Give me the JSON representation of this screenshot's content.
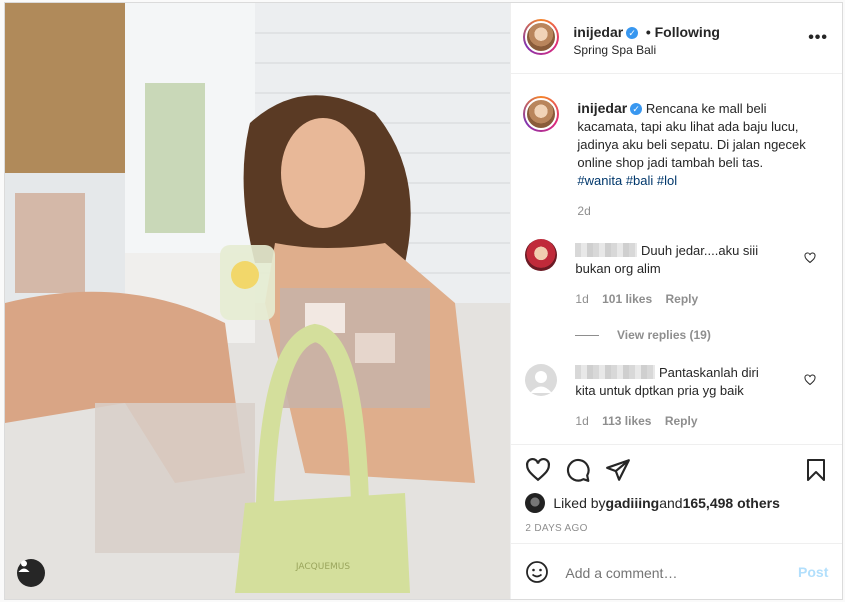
{
  "post": {
    "username": "inijedar",
    "following_label": "• Following",
    "location": "Spring Spa Bali",
    "caption": "Rencana ke mall beli kacamata, tapi aku lihat ada baju lucu, jadinya aku beli sepatu. Di jalan ngecek online shop jadi tambah beli tas.",
    "hashtags": [
      "#wanita",
      "#bali",
      "#lol"
    ],
    "caption_age": "2d",
    "bag_brand": "JACQUEMUS"
  },
  "comments": [
    {
      "text_line1": "Duuh jedar....aku siii",
      "text_line2": "bukan org alim",
      "age": "1d",
      "likes": "101 likes",
      "reply": "Reply"
    },
    {
      "text_line1": "Pantaskanlah diri",
      "text_line2": "kita untuk dptkan pria yg baik",
      "age": "1d",
      "likes": "113 likes",
      "reply": "Reply"
    }
  ],
  "view_replies": "View replies (19)",
  "likes": {
    "prefix": "Liked by ",
    "user": "gadiiing",
    "middle": " and ",
    "count": "165,498 others"
  },
  "timestamp": "2 DAYS AGO",
  "add_comment": {
    "placeholder": "Add a comment…",
    "post_label": "Post"
  },
  "colors": {
    "link": "#00376b",
    "post_button": "#b2dffc",
    "verified": "#3897f0"
  },
  "icons": [
    "more-icon",
    "heart-icon",
    "comment-icon",
    "share-icon",
    "bookmark-icon",
    "emoji-icon",
    "user-tag-icon",
    "verified-icon"
  ]
}
